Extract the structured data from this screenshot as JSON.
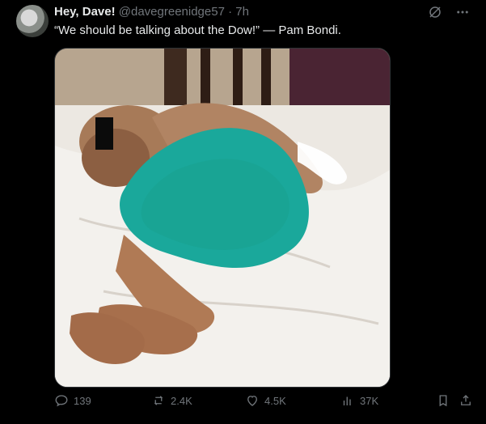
{
  "post": {
    "display_name": "Hey, Dave!",
    "handle": "@davegreenidge57",
    "separator": "·",
    "time": "7h",
    "text": "“We should be talking about the Dow!” — Pam Bondi.",
    "icons": [
      "grok-icon",
      "more-icon",
      "reply-icon",
      "repost-icon",
      "like-icon",
      "views-icon",
      "bookmark-icon",
      "share-icon"
    ],
    "metrics": {
      "replies": "139",
      "reposts": "2.4K",
      "likes": "4.5K",
      "views": "37K"
    }
  }
}
